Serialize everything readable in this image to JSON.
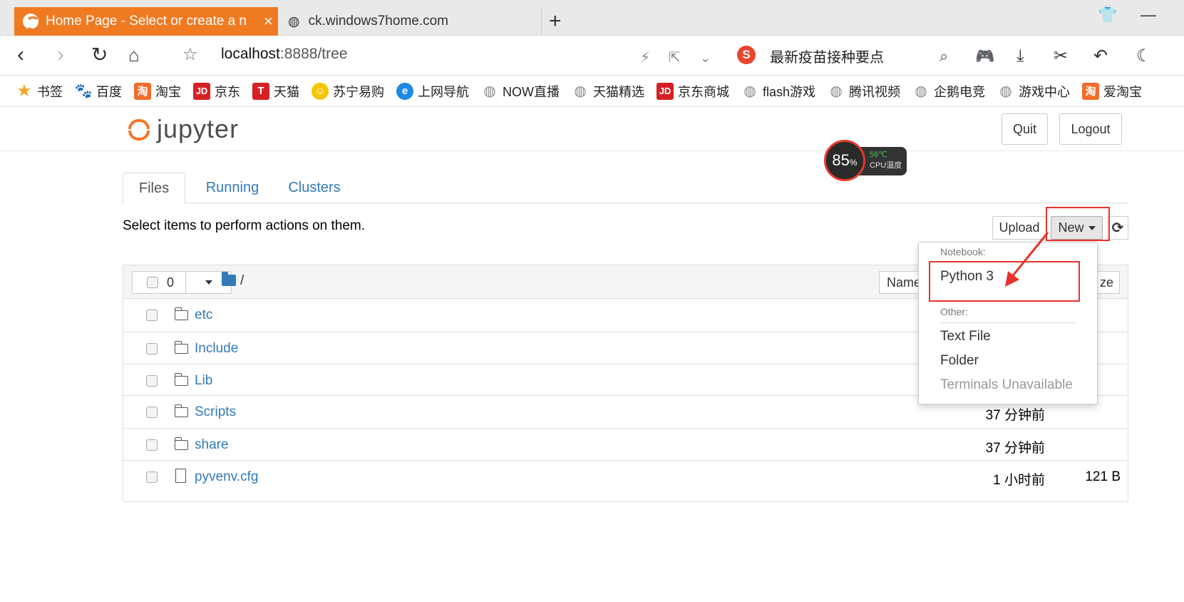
{
  "browser": {
    "tabs": [
      {
        "title": "Home Page - Select or create a n",
        "active": true
      },
      {
        "title": "ck.windows7home.com",
        "active": false
      }
    ],
    "url_host": "localhost",
    "url_rest": ":8888/tree",
    "search_text": "最新疫苗接种要点",
    "bookmarks": [
      "书签",
      "百度",
      "淘宝",
      "京东",
      "天猫",
      "苏宁易购",
      "上网导航",
      "NOW直播",
      "天猫精选",
      "京东商城",
      "flash游戏",
      "腾讯视频",
      "企鹅电竞",
      "游戏中心",
      "爱淘宝"
    ]
  },
  "jupyter": {
    "logo_text": "jupyter",
    "quit_label": "Quit",
    "logout_label": "Logout",
    "tabs": [
      "Files",
      "Running",
      "Clusters"
    ],
    "toolbar_text": "Select items to perform actions on them.",
    "upload_label": "Upload",
    "new_label": "New",
    "selected_count": "0",
    "root_path": "/",
    "name_sort_label": "Name",
    "size_sort_label_partial": "ze",
    "files": [
      {
        "name": "etc",
        "type": "folder",
        "modified": "",
        "size": ""
      },
      {
        "name": "Include",
        "type": "folder",
        "modified": "",
        "size": ""
      },
      {
        "name": "Lib",
        "type": "folder",
        "modified": "",
        "size": ""
      },
      {
        "name": "Scripts",
        "type": "folder",
        "modified": "37 分钟前",
        "size": ""
      },
      {
        "name": "share",
        "type": "folder",
        "modified": "37 分钟前",
        "size": ""
      },
      {
        "name": "pyvenv.cfg",
        "type": "file",
        "modified": "1 小时前",
        "size": "121 B"
      }
    ],
    "new_menu": {
      "notebook_header": "Notebook:",
      "notebook_items": [
        "Python 3"
      ],
      "other_header": "Other:",
      "other_items": [
        "Text File",
        "Folder",
        "Terminals Unavailable"
      ]
    }
  },
  "cpu_widget": {
    "percent": "85",
    "percent_unit": "%",
    "temperature": "56℃",
    "label": "CPU温度"
  },
  "colors": {
    "active_tab": "#f07a22",
    "jupyter_orange": "#f37626",
    "link_blue": "#337ab7",
    "annotation_red": "#e8322d"
  }
}
